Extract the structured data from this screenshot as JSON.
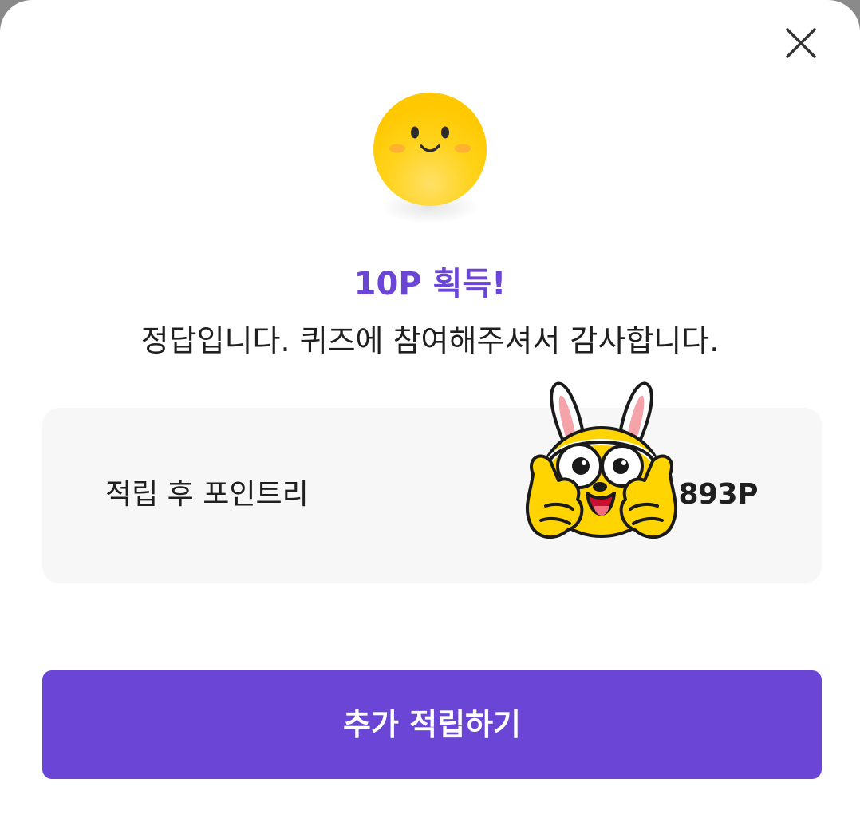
{
  "colors": {
    "accent": "#6B45D6",
    "card_background": "#F7F7F7",
    "text_primary": "#1F1F1F",
    "smiley_yellow": "#FFCB05"
  },
  "close_icon": "close-icon",
  "smiley_icon": "smiley-face-icon",
  "sticker_icon": "bunny-ear-character-sticker",
  "reward": {
    "title": "10P 획득!",
    "message": "정답입니다. 퀴즈에 참여해주셔서 감사합니다."
  },
  "points_card": {
    "label": "적립 후 포인트리",
    "value": "0,893P"
  },
  "actions": {
    "earn_more_label": "추가 적립하기"
  }
}
